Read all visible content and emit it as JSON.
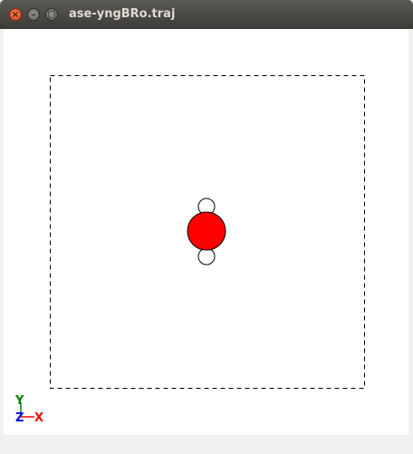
{
  "window": {
    "title": "ase-yngBRo.traj",
    "buttons": {
      "close_glyph": "×",
      "minimize_glyph": "–",
      "maximize_glyph": "□"
    }
  },
  "viewer": {
    "background_color": "#ffffff",
    "unit_cell": {
      "style": "dashed",
      "color": "#000000"
    },
    "atoms": [
      {
        "element": "H",
        "color": "#ffffff"
      },
      {
        "element": "O",
        "color": "#ff0000"
      },
      {
        "element": "H",
        "color": "#ffffff"
      }
    ],
    "axes": {
      "y_label": "Y",
      "z_label": "Z",
      "x_label": "X",
      "y_color": "#008000",
      "z_color": "#0000ff",
      "x_color": "#ff0000"
    }
  }
}
